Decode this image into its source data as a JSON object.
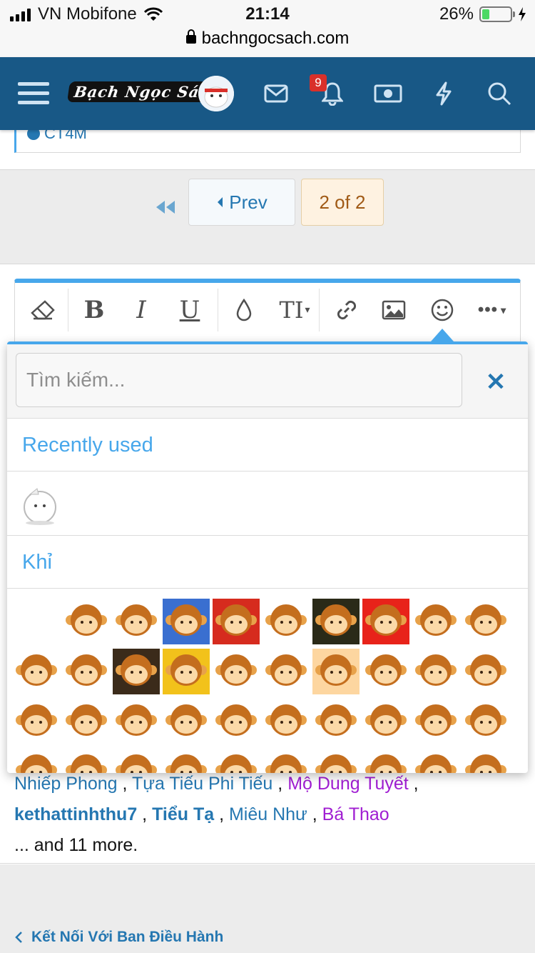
{
  "status_bar": {
    "carrier": "VN Mobifone",
    "time": "21:14",
    "battery": "26%",
    "battery_level": 0.26,
    "url": "bachngocsach.com"
  },
  "navbar": {
    "logo": "Bạch Ngọc Sách",
    "notification_count": "9",
    "icons": [
      "menu-icon",
      "avatar",
      "mail-icon",
      "bell-icon",
      "money-icon",
      "lightning-icon",
      "search-icon"
    ]
  },
  "prev_post": {
    "quote_label": "CT4M"
  },
  "pagination": {
    "prev_label": "Prev",
    "current_label": "2 of 2"
  },
  "toolbar": {
    "buttons": [
      "eraser-icon",
      "bold-icon",
      "italic-icon",
      "underline-icon",
      "color-drop-icon",
      "text-size-icon",
      "link-icon",
      "image-icon",
      "smiley-icon",
      "more-icon"
    ]
  },
  "emoji_popup": {
    "search_placeholder": "Tìm kiếm...",
    "recently_used_label": "Recently used",
    "category_label": "Khỉ"
  },
  "reactions": {
    "line1": [
      {
        "name": "Nhiếp Phong",
        "style": "u"
      },
      {
        "name": "Tựa Tiếu Phi Tiếu",
        "style": "u"
      },
      {
        "name": "Mộ Dung Tuyết",
        "style": "p"
      }
    ],
    "line2": [
      {
        "name": "kethattinhthu7",
        "style": "b"
      },
      {
        "name": "Tiểu Tạ",
        "style": "b"
      },
      {
        "name": "Miêu Như",
        "style": "u"
      },
      {
        "name": "Bá Thao",
        "style": "p"
      }
    ],
    "more_text": "... and 11 more."
  },
  "breadcrumb": {
    "label": "Kết Nối Với Ban Điều Hành"
  },
  "colors": {
    "navbar": "#185886",
    "accent": "#47a7eb",
    "link": "#2577b1",
    "purple_user": "#a01ed2",
    "current_page_bg": "#fef2e1"
  }
}
